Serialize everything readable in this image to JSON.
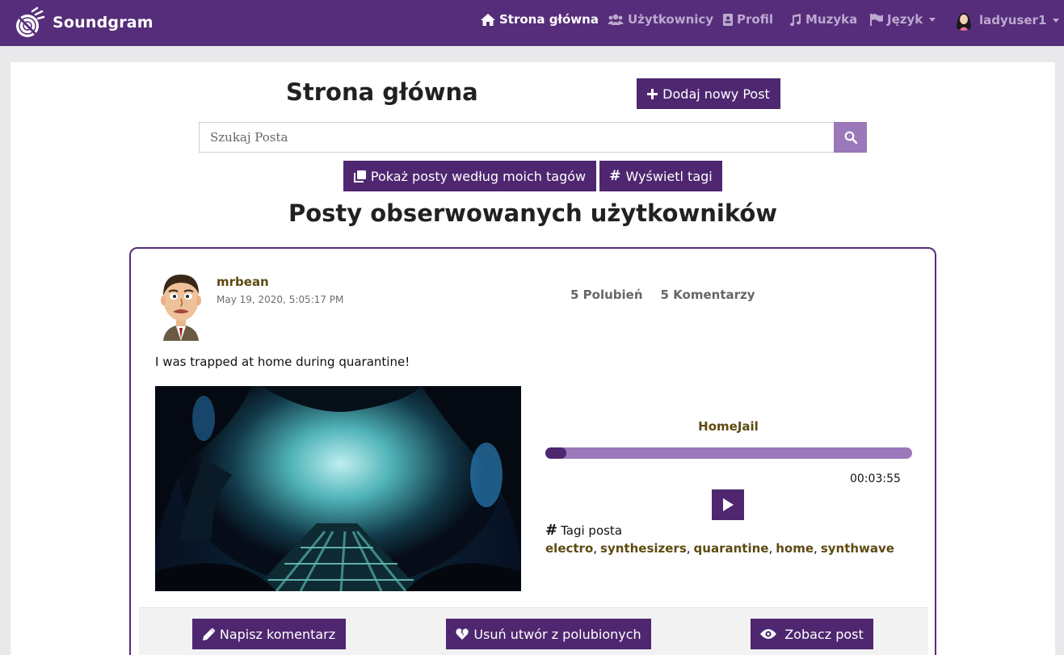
{
  "navbar": {
    "brand": "Soundgram",
    "items": [
      {
        "label": "Strona główna",
        "icon": "home-icon",
        "active": true
      },
      {
        "label": "Użytkownicy",
        "icon": "users-icon"
      },
      {
        "label": "Profil",
        "icon": "id-card-icon"
      },
      {
        "label": "Muzyka",
        "icon": "music-icon"
      },
      {
        "label": "Język",
        "icon": "flag-icon",
        "dropdown": true
      },
      {
        "label": "ladyuser1",
        "icon": "avatar",
        "dropdown": true
      }
    ]
  },
  "main": {
    "title": "Strona główna",
    "add_post_label": "Dodaj nowy Post",
    "search_placeholder": "Szukaj Posta",
    "my_tags_label": "Pokaż posty według moich tagów",
    "show_tags_label": "Wyświetl tagi",
    "section_title": "Posty obserwowanych użytkowników"
  },
  "post": {
    "author": "mrbean",
    "date": "May 19, 2020, 5:05:17 PM",
    "likes": "5 Polubień",
    "comments": "5 Komentarzy",
    "text": "I was trapped at home during quarantine!",
    "track_title": "HomeJail",
    "progress": 0.0,
    "time": "00:03:55",
    "tags_label": "Tagi posta",
    "tags": [
      "electro",
      "synthesizers",
      "quarantine",
      "home",
      "synthwave"
    ],
    "comment_label": "Napisz komentarz",
    "unlike_label": "Usuń utwór z polubionych",
    "view_label": "Zobacz post"
  },
  "colors": {
    "navbar": "#562d7a",
    "button": "#4e2770",
    "accent_light": "#9a78b9",
    "author_text": "#5e4a12"
  }
}
